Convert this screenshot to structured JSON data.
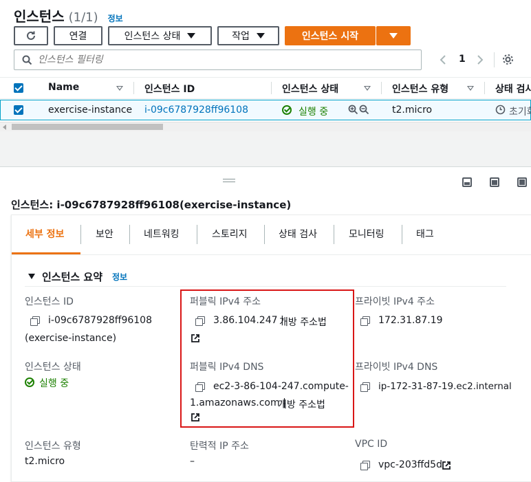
{
  "header": {
    "title": "인스턴스",
    "count": "(1/1)",
    "info_link": "정보"
  },
  "toolbar": {
    "connect_label": "연결",
    "instance_state_label": "인스턴스 상태",
    "actions_label": "작업",
    "launch_label": "인스턴스 시작"
  },
  "search": {
    "placeholder": "인스턴스 필터링"
  },
  "pagination": {
    "page": "1"
  },
  "table": {
    "headers": {
      "name": "Name",
      "instance_id": "인스턴스 ID",
      "instance_state": "인스턴스 상태",
      "instance_type": "인스턴스 유형",
      "status_check": "상태 검사"
    },
    "rows": [
      {
        "name": "exercise-instance",
        "instance_id": "i-09c6787928ff96108",
        "state": "실행 중",
        "type": "t2.micro",
        "status_check": "초기화"
      }
    ]
  },
  "detail": {
    "heading": "인스턴스: i-09c6787928ff96108(exercise-instance)",
    "tabs": [
      "세부 정보",
      "보안",
      "네트워킹",
      "스토리지",
      "상태 검사",
      "모니터링",
      "태그"
    ],
    "section_title": "인스턴스 요약",
    "section_info": "정보",
    "instance_id_label": "인스턴스 ID",
    "instance_id_value": "i-09c6787928ff96108",
    "instance_id_name": "(exercise-instance)",
    "public_ipv4_label": "퍼블릭 IPv4 주소",
    "public_ipv4_value": "3.86.104.247 |",
    "public_ipv4_open": "개방 주소법",
    "private_ipv4_label": "프라이빗 IPv4 주소",
    "private_ipv4_value": "172.31.87.19",
    "instance_state_label": "인스턴스 상태",
    "instance_state_value": "실행 중",
    "public_dns_label": "퍼블릭 IPv4 DNS",
    "public_dns_line1": "ec2-3-86-104-247.compute-",
    "public_dns_line2": "1.amazonaws.com |",
    "public_dns_open": "개방 주소법",
    "private_dns_label": "프라이빗 IPv4 DNS",
    "private_dns_value": "ip-172-31-87-19.ec2.internal",
    "instance_type_label": "인스턴스 유형",
    "instance_type_value": "t2.micro",
    "elastic_ip_label": "탄력적 IP 주소",
    "elastic_ip_value": "–",
    "vpc_label": "VPC ID",
    "vpc_value": "vpc-203ffd5d"
  },
  "colors": {
    "accent_orange": "#ec7211",
    "link_blue": "#0073bb",
    "success_green": "#1d8102",
    "highlight_red": "#d91515"
  }
}
